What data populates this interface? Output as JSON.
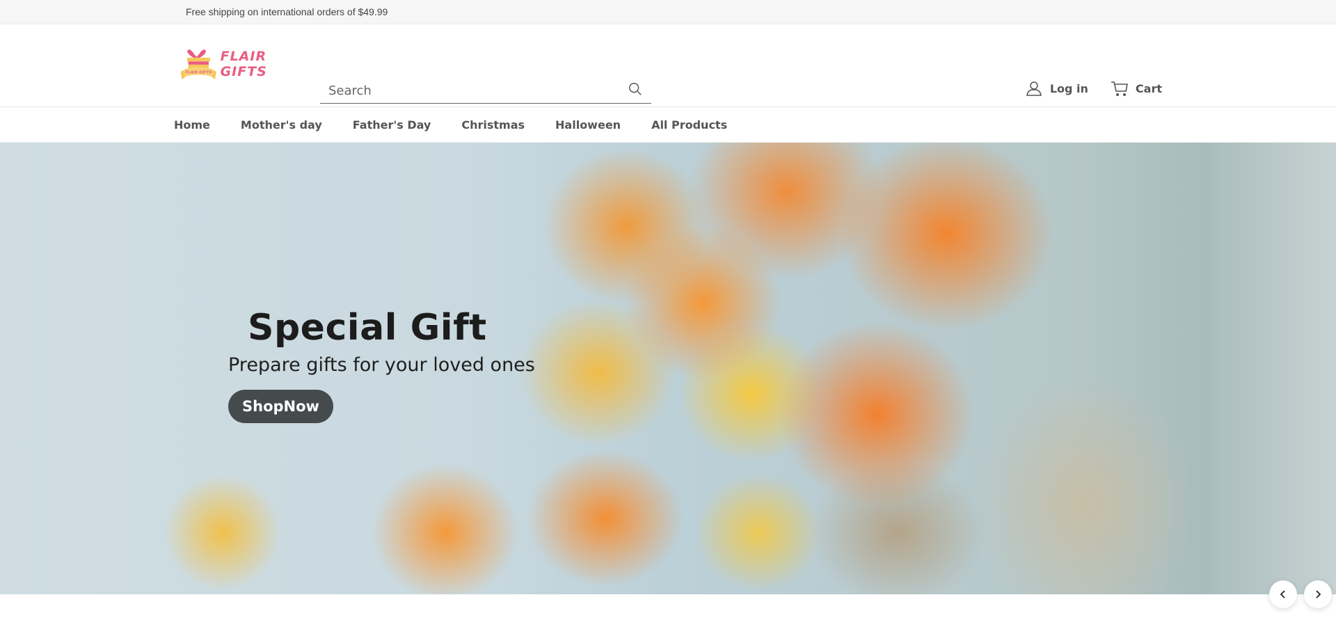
{
  "announcement": {
    "text": "Free shipping on international orders of $49.99"
  },
  "header": {
    "logo": {
      "text": "FLAIR GIFTS",
      "badge_text": "FLAIR GIFTS",
      "colors": {
        "pink": "#e85d83",
        "yellow": "#f6c85a"
      }
    },
    "search": {
      "placeholder": "Search",
      "value": "",
      "icon": "search-icon"
    },
    "actions": [
      {
        "label": "Log in",
        "icon": "user-icon"
      },
      {
        "label": "Cart",
        "icon": "cart-icon"
      }
    ]
  },
  "nav": {
    "items": [
      {
        "label": "Home"
      },
      {
        "label": "Mother's day"
      },
      {
        "label": "Father's Day"
      },
      {
        "label": "Christmas"
      },
      {
        "label": "Halloween"
      },
      {
        "label": "All Products"
      }
    ]
  },
  "hero": {
    "title": "Special Gift",
    "subtitle": "Prepare gifts for your loved ones",
    "cta_label": "ShopNow",
    "image_description": "bouquet of orange ranunculus flowers held against denim",
    "button_color": "#454a4c"
  },
  "slider": {
    "prev_icon": "chevron-left-icon",
    "next_icon": "chevron-right-icon"
  }
}
